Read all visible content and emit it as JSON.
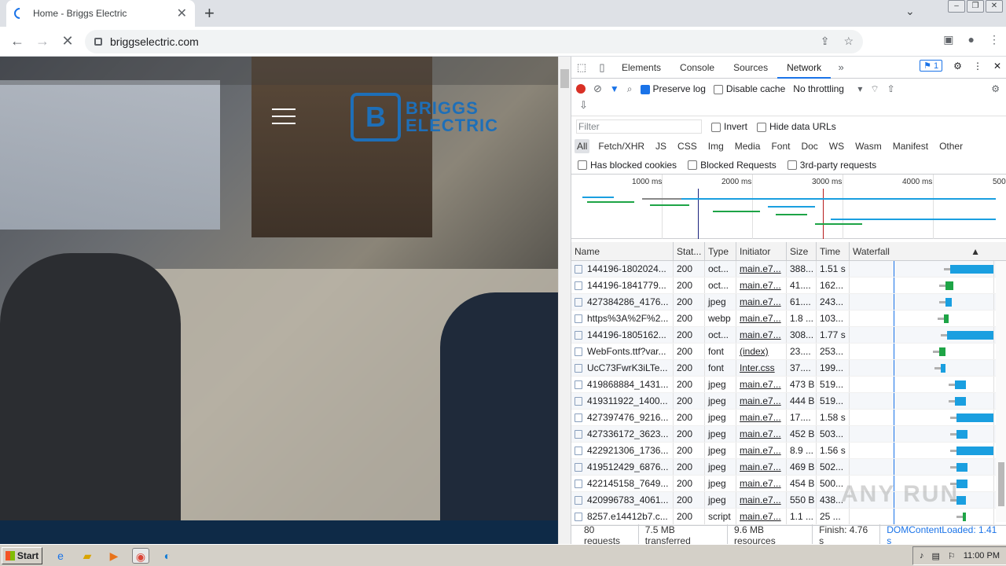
{
  "browser": {
    "tab_title": "Home - Briggs Electric",
    "url": "briggselectric.com"
  },
  "site": {
    "logo_initials": "B",
    "logo_line1": "BRIGGS",
    "logo_line2": "ELECTRIC"
  },
  "devtools": {
    "tabs": [
      "Elements",
      "Console",
      "Sources",
      "Network"
    ],
    "active_tab": "Network",
    "issues_count": "1",
    "preserve_log": "Preserve log",
    "disable_cache": "Disable cache",
    "throttling": "No throttling",
    "filter_placeholder": "Filter",
    "invert": "Invert",
    "hide_data_urls": "Hide data URLs",
    "type_filters": [
      "All",
      "Fetch/XHR",
      "JS",
      "CSS",
      "Img",
      "Media",
      "Font",
      "Doc",
      "WS",
      "Wasm",
      "Manifest",
      "Other"
    ],
    "blocked_cookies": "Has blocked cookies",
    "blocked_requests": "Blocked Requests",
    "third_party": "3rd-party requests",
    "timeline_ticks": [
      "1000 ms",
      "2000 ms",
      "3000 ms",
      "4000 ms",
      "500"
    ],
    "columns": [
      "Name",
      "Stat...",
      "Type",
      "Initiator",
      "Size",
      "Time",
      "Waterfall"
    ],
    "rows": [
      {
        "name": "144196-1802024...",
        "status": "200",
        "type": "oct...",
        "initiator": "main.e7...",
        "size": "388...",
        "time": "1.51 s"
      },
      {
        "name": "144196-1841779...",
        "status": "200",
        "type": "oct...",
        "initiator": "main.e7...",
        "size": "41....",
        "time": "162..."
      },
      {
        "name": "427384286_4176...",
        "status": "200",
        "type": "jpeg",
        "initiator": "main.e7...",
        "size": "61....",
        "time": "243..."
      },
      {
        "name": "https%3A%2F%2...",
        "status": "200",
        "type": "webp",
        "initiator": "main.e7...",
        "size": "1.8 ...",
        "time": "103..."
      },
      {
        "name": "144196-1805162...",
        "status": "200",
        "type": "oct...",
        "initiator": "main.e7...",
        "size": "308...",
        "time": "1.77 s"
      },
      {
        "name": "WebFonts.ttf?var...",
        "status": "200",
        "type": "font",
        "initiator": "(index)",
        "size": "23....",
        "time": "253..."
      },
      {
        "name": "UcC73FwrK3iLTe...",
        "status": "200",
        "type": "font",
        "initiator": "Inter.css",
        "size": "37....",
        "time": "199..."
      },
      {
        "name": "419868884_1431...",
        "status": "200",
        "type": "jpeg",
        "initiator": "main.e7...",
        "size": "473 B",
        "time": "519..."
      },
      {
        "name": "419311922_1400...",
        "status": "200",
        "type": "jpeg",
        "initiator": "main.e7...",
        "size": "444 B",
        "time": "519..."
      },
      {
        "name": "427397476_9216...",
        "status": "200",
        "type": "jpeg",
        "initiator": "main.e7...",
        "size": "17....",
        "time": "1.58 s"
      },
      {
        "name": "427336172_3623...",
        "status": "200",
        "type": "jpeg",
        "initiator": "main.e7...",
        "size": "452 B",
        "time": "503..."
      },
      {
        "name": "422921306_1736...",
        "status": "200",
        "type": "jpeg",
        "initiator": "main.e7...",
        "size": "8.9 ...",
        "time": "1.56 s"
      },
      {
        "name": "419512429_6876...",
        "status": "200",
        "type": "jpeg",
        "initiator": "main.e7...",
        "size": "469 B",
        "time": "502..."
      },
      {
        "name": "422145158_7649...",
        "status": "200",
        "type": "jpeg",
        "initiator": "main.e7...",
        "size": "454 B",
        "time": "500..."
      },
      {
        "name": "420996783_4061...",
        "status": "200",
        "type": "jpeg",
        "initiator": "main.e7...",
        "size": "550 B",
        "time": "438..."
      },
      {
        "name": "8257.e14412b7.c...",
        "status": "200",
        "type": "script",
        "initiator": "main.e7...",
        "size": "1.1 ...",
        "time": "25 ..."
      }
    ],
    "status_bar": {
      "requests": "80 requests",
      "transferred": "7.5 MB transferred",
      "resources": "9.6 MB resources",
      "finish": "Finish: 4.76 s",
      "dcl": "DOMContentLoaded: 1.41 s"
    }
  },
  "taskbar": {
    "start": "Start",
    "clock": "11:00 PM"
  },
  "watermark": "ANY RUN",
  "colors": {
    "accent": "#1a73e8",
    "brand": "#1e6fb8",
    "waterfall_bar": "#1a9fe0",
    "waterfall_green": "#1ea446"
  }
}
